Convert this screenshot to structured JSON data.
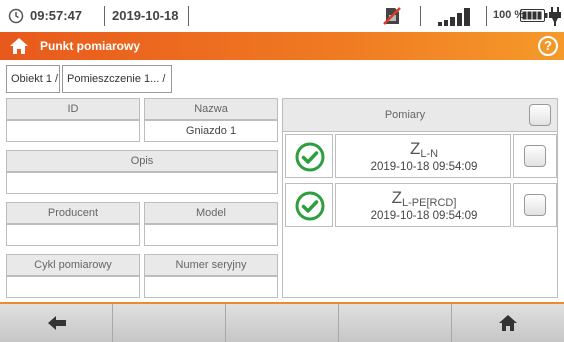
{
  "status_bar": {
    "time": "09:57:47",
    "date": "2019-10-18",
    "battery_percent": "100 %",
    "icons": [
      "clock-icon",
      "no-sim-icon",
      "signal-strength-icon",
      "battery-icon",
      "power-plug-icon"
    ]
  },
  "title_bar": {
    "title": "Punkt pomiarowy",
    "help_label": "?",
    "accent_color": "#f07a22"
  },
  "breadcrumb": {
    "items": [
      "Obiekt 1 /",
      "Pomieszczenie 1... /"
    ]
  },
  "form": {
    "id": {
      "label": "ID",
      "value": ""
    },
    "name": {
      "label": "Nazwa",
      "value": "Gniazdo 1"
    },
    "description": {
      "label": "Opis",
      "value": ""
    },
    "producer": {
      "label": "Producent",
      "value": ""
    },
    "model": {
      "label": "Model",
      "value": ""
    },
    "cycle": {
      "label": "Cykl pomiarowy",
      "value": ""
    },
    "serial": {
      "label": "Numer seryjny",
      "value": ""
    }
  },
  "measurements": {
    "header": "Pomiary",
    "rows": [
      {
        "name": "Z",
        "sub": "L-N",
        "timestamp": "2019-10-18 09:54:09",
        "status": "ok"
      },
      {
        "name": "Z",
        "sub": "L-PE[RCD]",
        "timestamp": "2019-10-18 09:54:09",
        "status": "ok"
      }
    ]
  },
  "bottom_bar": {
    "buttons": [
      "back-arrow-icon",
      "",
      "",
      "",
      "home-icon"
    ]
  }
}
